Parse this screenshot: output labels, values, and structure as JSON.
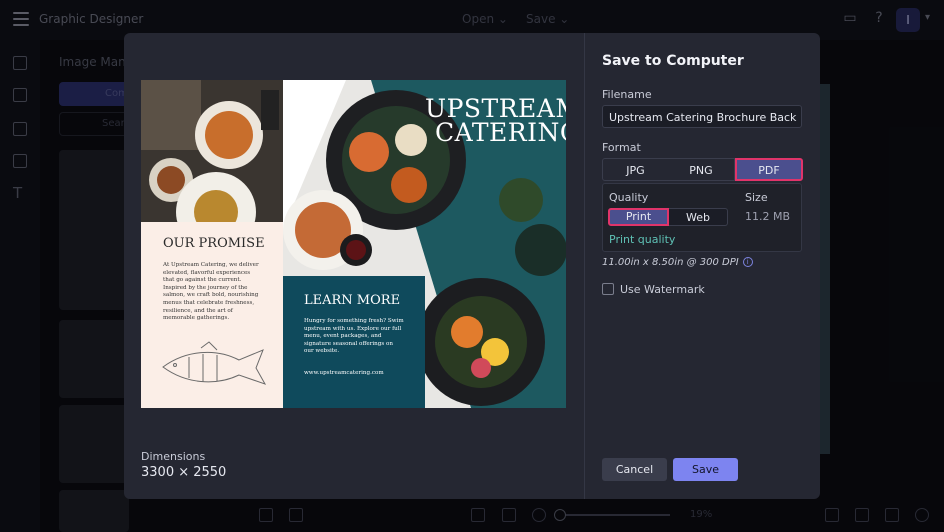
{
  "app": {
    "title": "Graphic Designer"
  },
  "topbar": {
    "open_label": "Open",
    "save_label": "Save",
    "user_initial": "I"
  },
  "left_panel": {
    "title": "Image Mana",
    "button_label": "Com",
    "search_placeholder": "Sear"
  },
  "bottom_toolbar": {
    "zoom": "19%"
  },
  "dialog": {
    "title": "Save to Computer",
    "filename_label": "Filename",
    "filename_value": "Upstream Catering Brochure Back",
    "format_label": "Format",
    "formats": [
      "JPG",
      "PNG",
      "PDF"
    ],
    "selected_format": "PDF",
    "quality_label": "Quality",
    "qualities": [
      "Print",
      "Web"
    ],
    "selected_quality": "Print",
    "size_label": "Size",
    "size_value": "11.2 MB",
    "quality_link": "Print quality",
    "spec_text": "11.00in x 8.50in @ 300 DPI",
    "watermark_label": "Use Watermark",
    "watermark_checked": false,
    "dimensions_label": "Dimensions",
    "dimensions_value": "3300 × 2550",
    "cancel_label": "Cancel",
    "save_label": "Save"
  },
  "brochure": {
    "brand_line1": "UPSTREAM",
    "brand_line2": "CATERING",
    "promise_title": "OUR PROMISE",
    "promise_body": "At Upstream Catering, we deliver elevated, flavorful experiences that go against the current. Inspired by the journey of the salmon, we craft bold, nourishing menus that celebrate freshness, resilience, and the art of memorable gatherings.",
    "learn_title": "LEARN MORE",
    "learn_body": "Hungry for something fresh? Swim upstream with us. Explore our full menu, event packages, and signature seasonal offerings on our website.",
    "website": "www.upstreamcatering.com"
  },
  "colors": {
    "accent": "#7d84f0",
    "highlight": "#e0346a",
    "link": "#5fc1b5",
    "teal_panel": "#0f4a5c",
    "cream_panel": "#fbeee7"
  }
}
